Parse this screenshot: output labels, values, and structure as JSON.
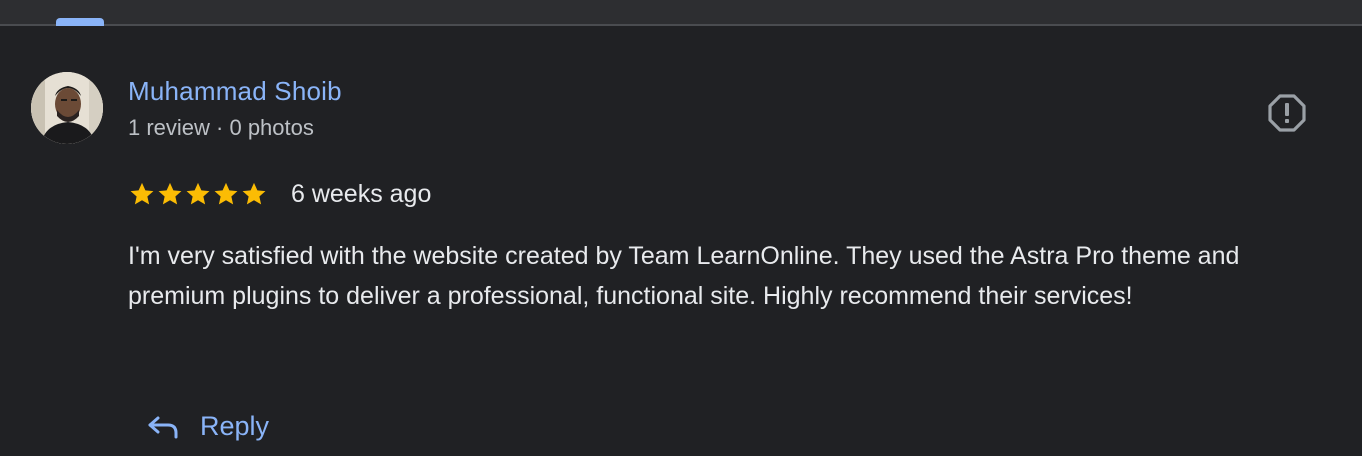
{
  "review": {
    "author": {
      "name": "Muhammad Shoib",
      "meta": "1 review · 0 photos",
      "avatar_icon": "profile-photo"
    },
    "rating": 5,
    "rating_max": 5,
    "time_ago": "6 weeks ago",
    "text": "I'm very satisfied with the website created by Team LearnOnline. They used the Astra Pro theme and premium plugins to deliver a professional, functional site. Highly recommend their services!",
    "report_icon": "report-icon",
    "reply": {
      "label": "Reply",
      "icon": "reply-arrow-icon"
    }
  },
  "colors": {
    "background": "#202124",
    "accent": "#8ab4f8",
    "star": "#fbbc04",
    "text": "#e8eaed",
    "secondary_text": "#bdc1c6"
  }
}
